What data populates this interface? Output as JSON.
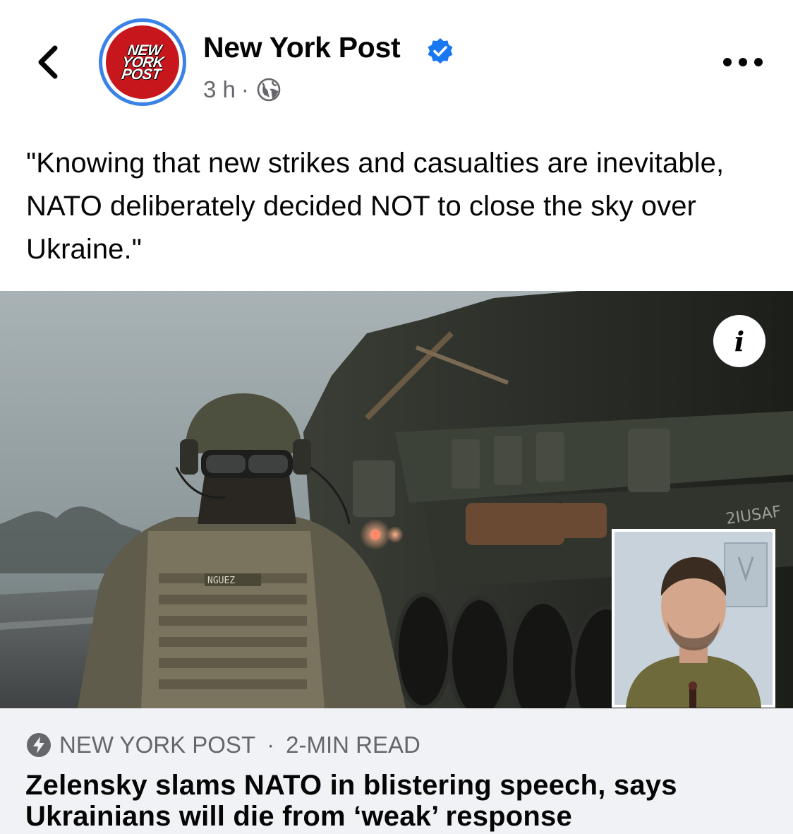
{
  "header": {
    "page_name": "New York Post",
    "logo_lines": [
      "NEW",
      "YORK",
      "POST"
    ],
    "time": "3 h",
    "separator": "·",
    "privacy_icon": "globe-icon",
    "back_icon": "chevron-left-icon",
    "more_icon": "more-horizontal-icon",
    "verified_icon": "verified-badge-icon"
  },
  "post": {
    "caption": "\"Knowing that new strikes and casualties are inevitable, NATO deliberately decided NOT to close the sky over Ukraine.\""
  },
  "image": {
    "info_icon": "info-icon",
    "info_glyph": "i",
    "patch_label": "NGUEZ",
    "vehicle_marking": "2IUSAF"
  },
  "link_card": {
    "source_icon": "lightning-bolt-icon",
    "source": "NEW YORK POST",
    "separator": "·",
    "read_time": "2-MIN READ",
    "headline": "Zelensky slams NATO in blistering speech, says Ukrainians will die from ‘weak’ response"
  },
  "colors": {
    "accent_blue": "#3b82e6",
    "logo_red": "#c8161d",
    "secondary_text": "#65676b",
    "card_background": "#f0f2f5"
  }
}
